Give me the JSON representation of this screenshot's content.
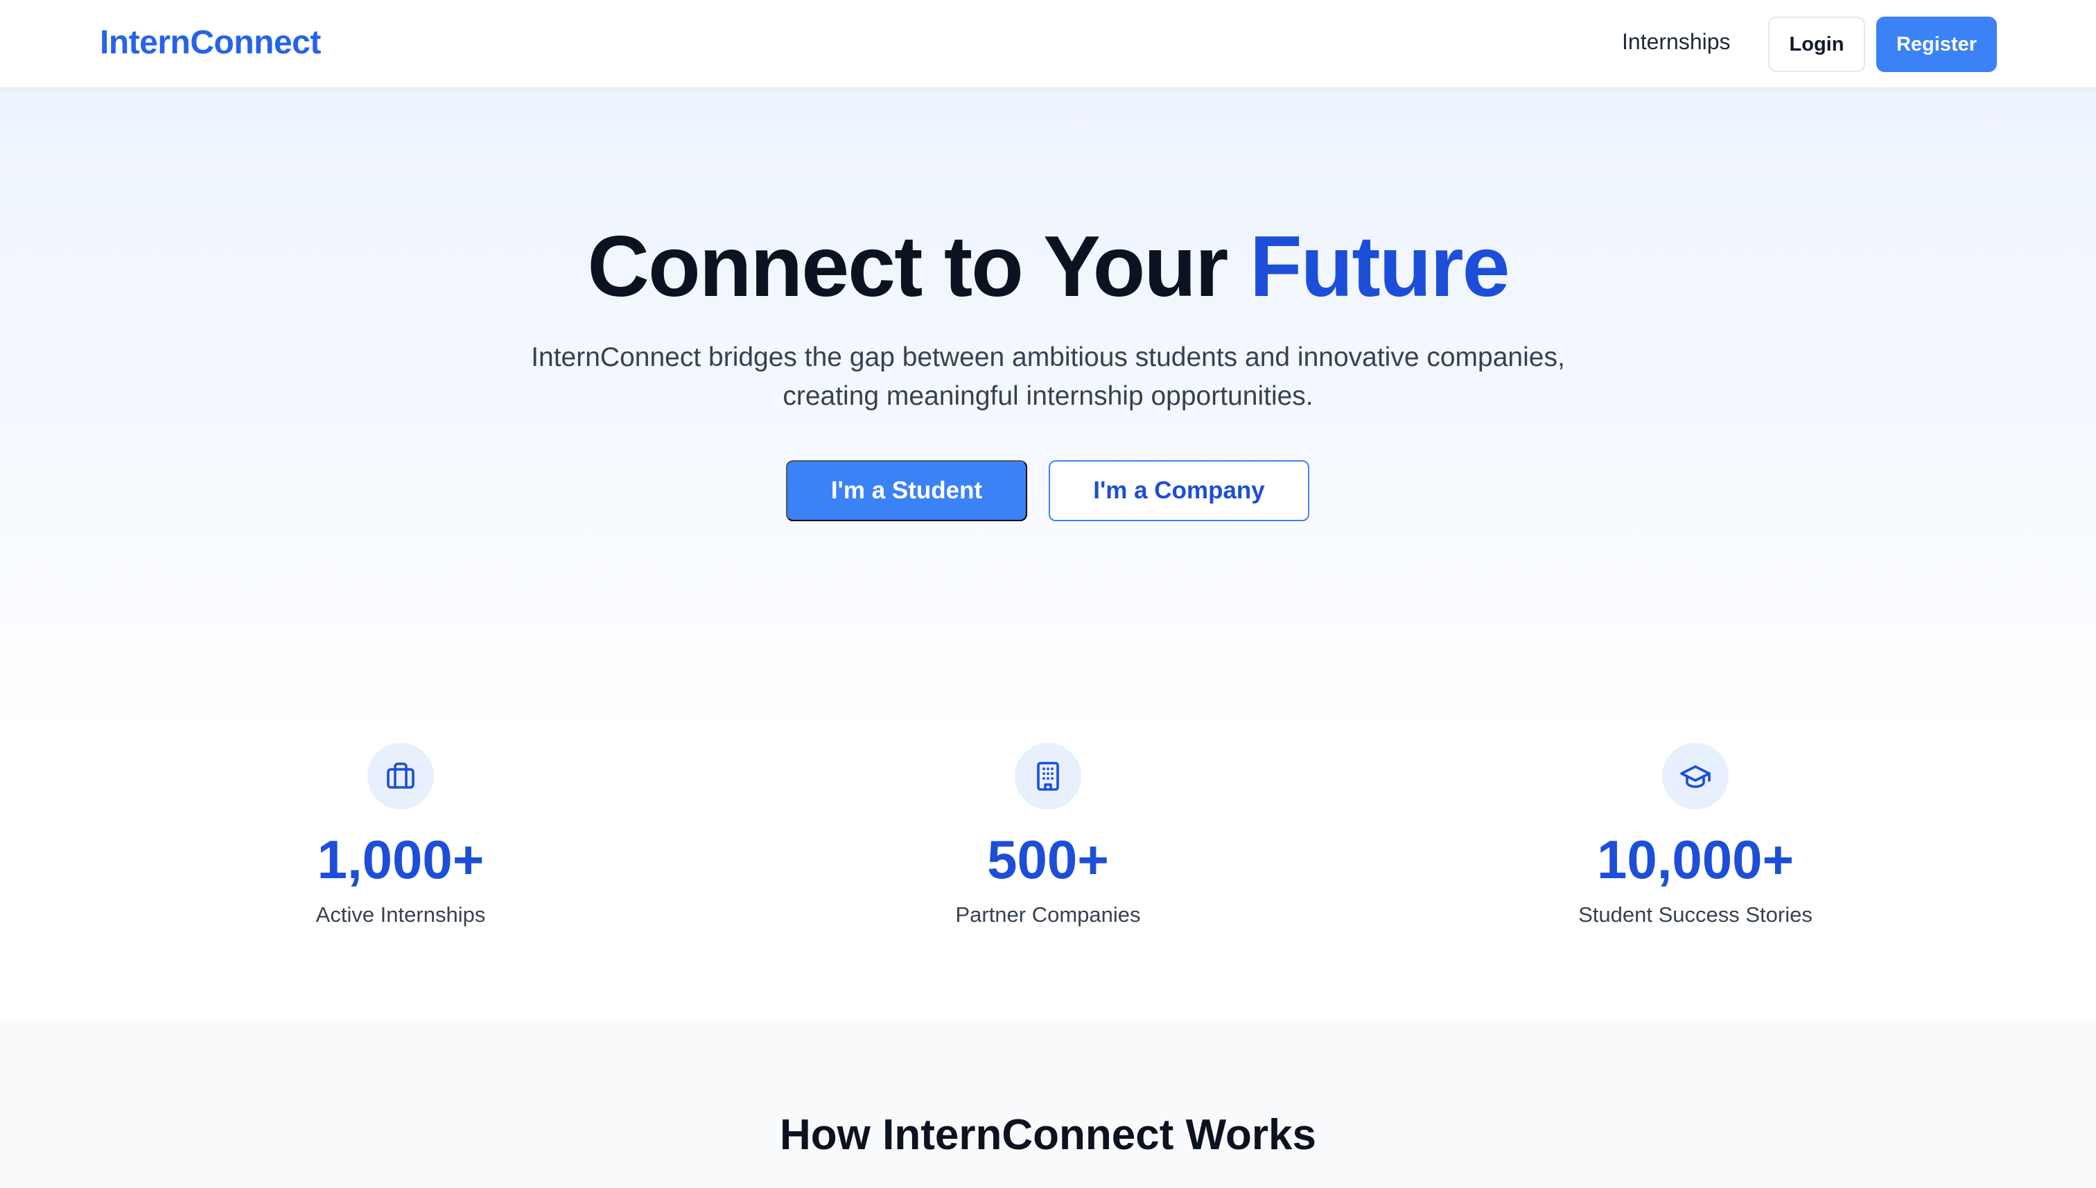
{
  "header": {
    "logo": "InternConnect",
    "nav": {
      "internships": "Internships"
    },
    "login_label": "Login",
    "register_label": "Register"
  },
  "hero": {
    "title_main": "Connect to Your ",
    "title_accent": "Future",
    "subtitle_line1": "InternConnect bridges the gap between ambitious students and innovative companies,",
    "subtitle_line2": "creating meaningful internship opportunities.",
    "cta_student": "I'm a Student",
    "cta_company": "I'm a Company"
  },
  "stats": [
    {
      "icon": "briefcase-icon",
      "value": "1,000+",
      "label": "Active Internships"
    },
    {
      "icon": "building-icon",
      "value": "500+",
      "label": "Partner Companies"
    },
    {
      "icon": "graduation-cap-icon",
      "value": "10,000+",
      "label": "Student Success Stories"
    }
  ],
  "how_it_works": {
    "title": "How InternConnect Works"
  },
  "colors": {
    "brand": "#2563eb",
    "accent": "#1d4ed8",
    "button_primary": "#3b82f6",
    "icon_bg": "#e8f0fe",
    "section_bg": "#f8fafc"
  }
}
